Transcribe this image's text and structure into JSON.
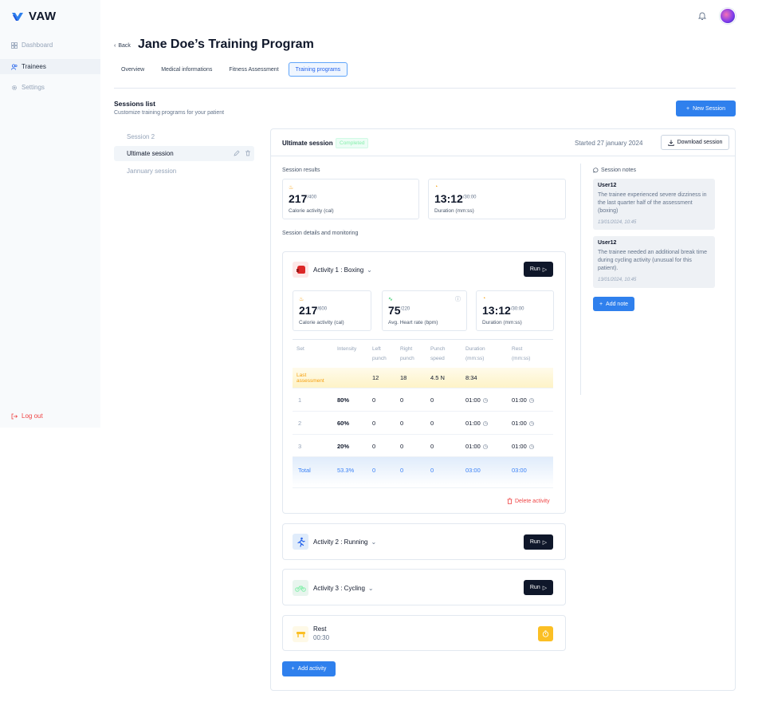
{
  "app": {
    "name": "VAW",
    "brand_color": "#2f80ed"
  },
  "sidebar": {
    "items": [
      {
        "label": "Dashboard",
        "icon": "dashboard-icon"
      },
      {
        "label": "Trainees",
        "icon": "users-icon"
      },
      {
        "label": "Settings",
        "icon": "gear-icon"
      }
    ],
    "logout": "Log out"
  },
  "header": {
    "back": "Back",
    "title": "Jane Doe’s Training Program"
  },
  "tabs": [
    {
      "label": "Overview"
    },
    {
      "label": "Medical informations"
    },
    {
      "label": "Fitness Assessment"
    },
    {
      "label": "Training programs"
    }
  ],
  "sessions": {
    "title": "Sessions list",
    "subtitle": "Customize training programs for your patient",
    "new_button": "New Session",
    "items": [
      {
        "label": "Session 2"
      },
      {
        "label": "Ultimate session"
      },
      {
        "label": "Jannuary session"
      }
    ]
  },
  "session": {
    "title": "Ultimate session",
    "status": "Completed",
    "started": "Started 27 january 2024",
    "download": "Download session",
    "results_label": "Session results",
    "results": [
      {
        "value": "217",
        "max": "/400",
        "label": "Calorie activity (cal)"
      },
      {
        "value": "13:12",
        "max": "/30:00",
        "label": "Duration (mm:ss)"
      }
    ],
    "details_label": "Session details and monitoring"
  },
  "activities": [
    {
      "title": "Activity 1 : Boxing",
      "run": "Run",
      "stats": [
        {
          "value": "217",
          "max": "/600",
          "label": "Calorie activity (cal)"
        },
        {
          "value": "75",
          "max": "/220",
          "label": "Avg. Heart rate (bpm)"
        },
        {
          "value": "13:12",
          "max": "/30:00",
          "label": "Duration (mm:ss)"
        }
      ],
      "table": {
        "headers": [
          "Set",
          "Intensity",
          "Left punch",
          "Right punch",
          "Punch speed",
          "Duration (mm:ss)",
          "Rest (mm:ss)"
        ],
        "last_assessment": {
          "label": "Last assessment",
          "left": "12",
          "right": "18",
          "speed": "4.5 N",
          "duration": "8:34"
        },
        "rows": [
          {
            "set": "1",
            "intensity": "80%",
            "left": "0",
            "right": "0",
            "speed": "0",
            "duration": "01:00",
            "rest": "01:00"
          },
          {
            "set": "2",
            "intensity": "60%",
            "left": "0",
            "right": "0",
            "speed": "0",
            "duration": "01:00",
            "rest": "01:00"
          },
          {
            "set": "3",
            "intensity": "20%",
            "left": "0",
            "right": "0",
            "speed": "0",
            "duration": "01:00",
            "rest": "01:00"
          }
        ],
        "total": {
          "label": "Total",
          "intensity": "53.3%",
          "left": "0",
          "right": "0",
          "speed": "0",
          "duration": "03:00",
          "rest": "03:00"
        }
      },
      "delete": "Delete activity"
    },
    {
      "title": "Activity 2 : Running",
      "run": "Run"
    },
    {
      "title": "Activity 3 : Cycling",
      "run": "Run"
    }
  ],
  "rest": {
    "title": "Rest",
    "time": "00:30"
  },
  "add_activity": "Add activity",
  "notes": {
    "title": "Session notes",
    "items": [
      {
        "user": "User12",
        "text": "The trainee experienced severe dizziness in the last quarter half of the assessment (boxing)",
        "date": "13/01/2024, 10:45"
      },
      {
        "user": "User12",
        "text": "The trainee needed an additional break time during cycling activity (unusual for this patient).",
        "date": "13/01/2024, 10:45"
      }
    ],
    "add": "Add note"
  }
}
